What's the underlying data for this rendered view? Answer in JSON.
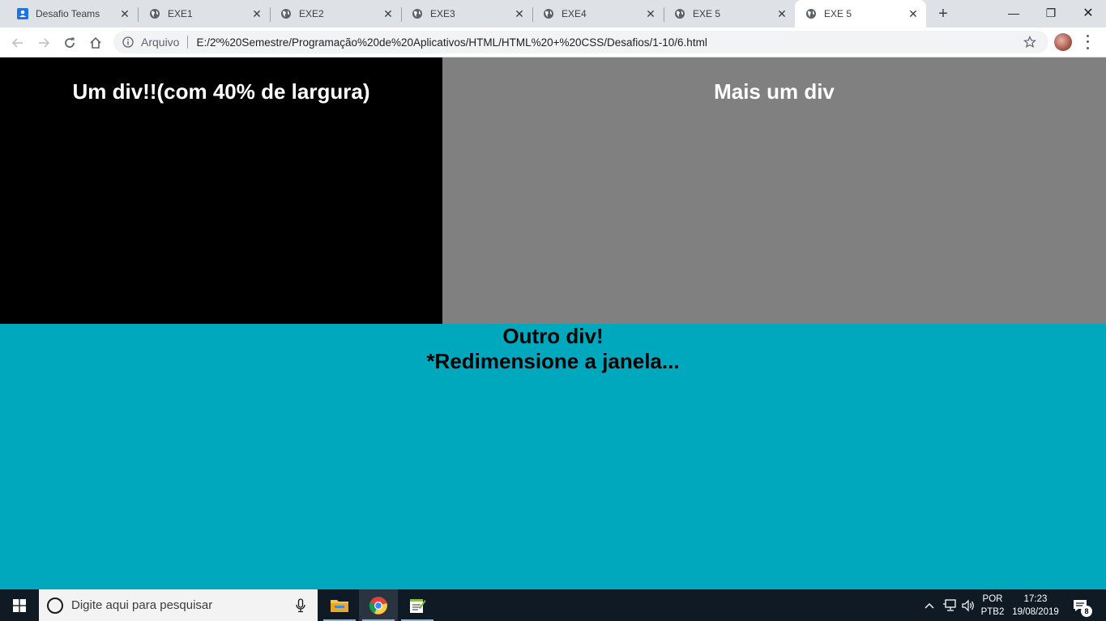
{
  "browser": {
    "tabs": [
      {
        "title": "Desafio Teams",
        "icon": "teams-icon",
        "active": false
      },
      {
        "title": "EXE1",
        "icon": "globe-icon",
        "active": false
      },
      {
        "title": "EXE2",
        "icon": "globe-icon",
        "active": false
      },
      {
        "title": "EXE3",
        "icon": "globe-icon",
        "active": false
      },
      {
        "title": "EXE4",
        "icon": "globe-icon",
        "active": false
      },
      {
        "title": "EXE 5",
        "icon": "globe-icon",
        "active": false
      },
      {
        "title": "EXE 5",
        "icon": "globe-icon",
        "active": true
      }
    ],
    "close_glyph": "✕",
    "new_tab_glyph": "+",
    "window_controls": {
      "minimize": "—",
      "restore": "❐",
      "close": "✕"
    },
    "omnibox": {
      "scheme_label": "Arquivo",
      "url": "E:/2º%20Semestre/Programação%20de%20Aplicativos/HTML/HTML%20+%20CSS/Desafios/1-10/6.html"
    }
  },
  "page": {
    "div1_text": "Um div!!(com 40% de largura)",
    "div2_text": "Mais um div",
    "div3_line1": "Outro div!",
    "div3_line2": "*Redimensione a janela...",
    "colors": {
      "div1": "#000000",
      "div2": "#808080",
      "div3": "#00a8bd"
    }
  },
  "taskbar": {
    "search_placeholder": "Digite aqui para pesquisar",
    "language_top": "POR",
    "language_bottom": "PTB2",
    "time": "17:23",
    "date": "19/08/2019",
    "notification_count": "8"
  }
}
